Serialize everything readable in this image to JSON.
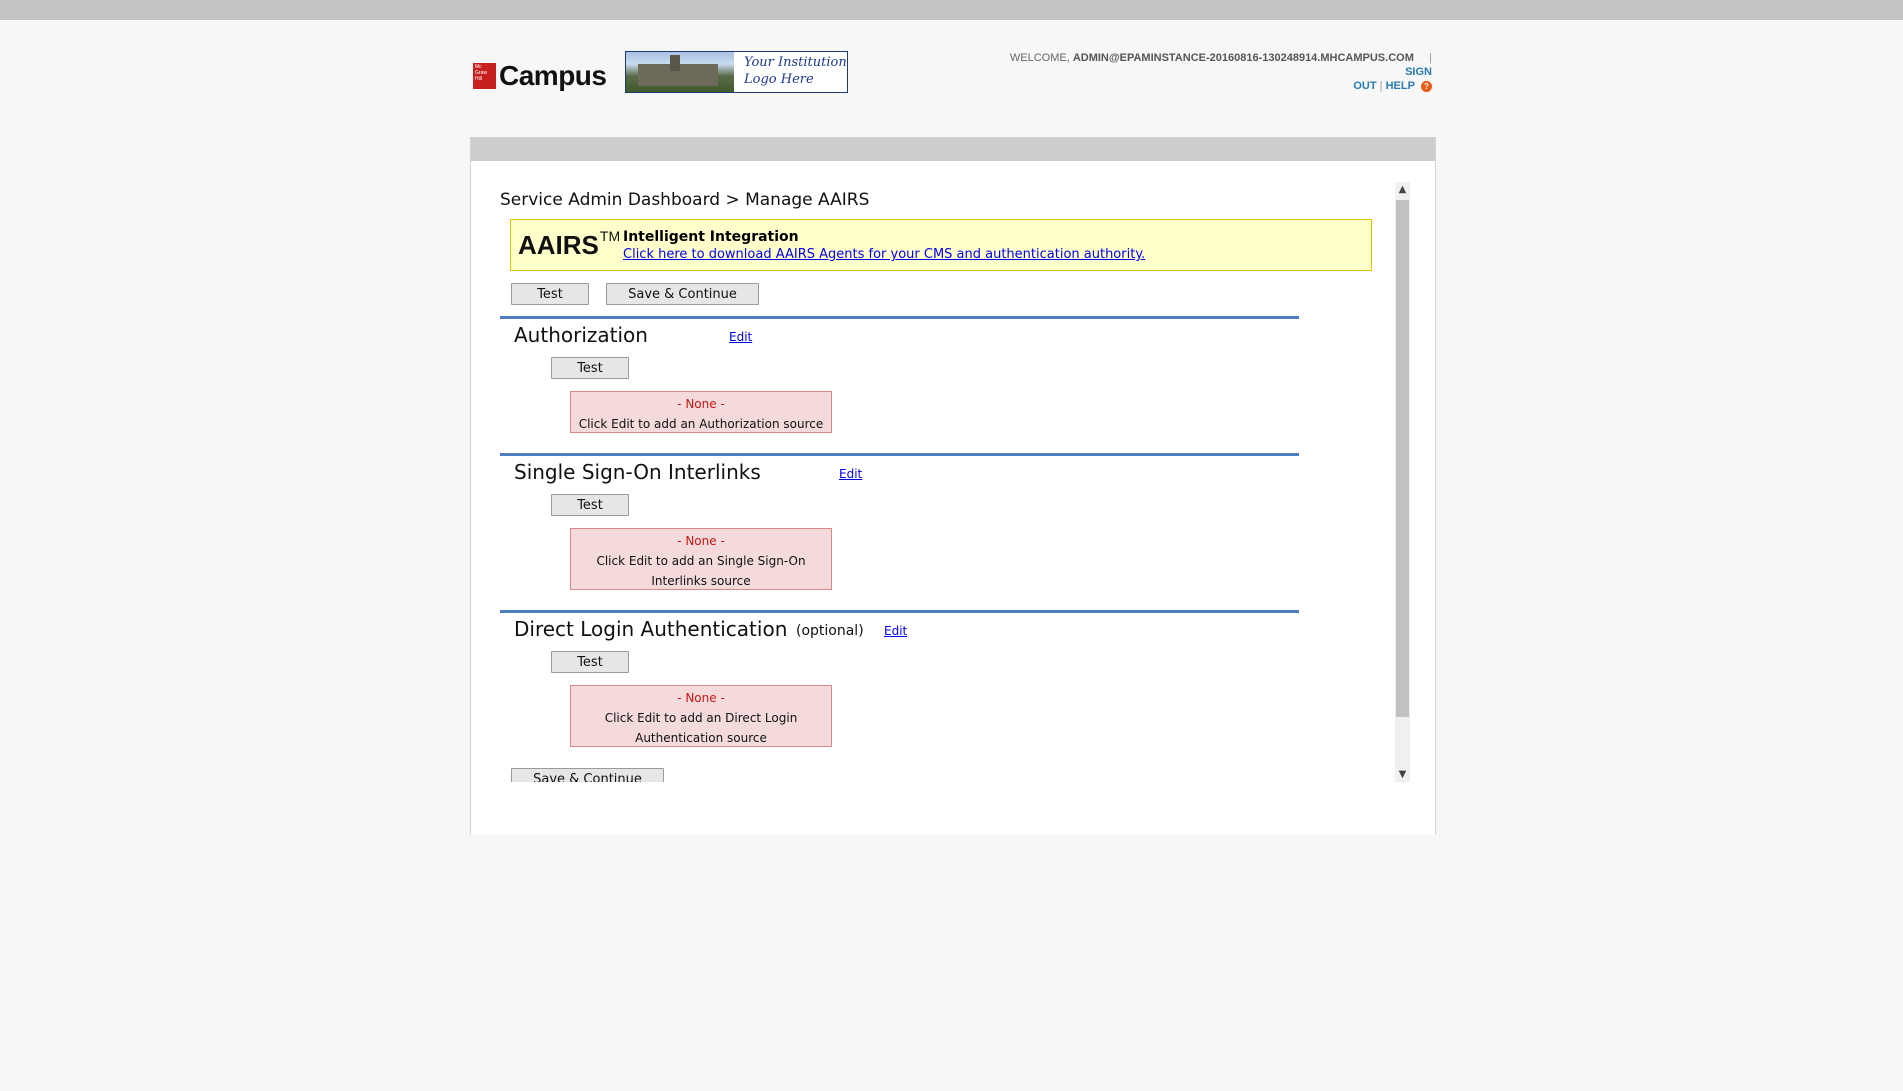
{
  "header": {
    "logo_text": "Campus",
    "logo_badge_text": "Mc Graw Hill",
    "institution_logo_line1": "Your Institution",
    "institution_logo_line2": "Logo Here",
    "welcome_prefix": "WELCOME,",
    "user_email": "ADMIN@EPAMINSTANCE-20160816-130248914.MHCAMPUS.COM",
    "sign_out_part1": "SIGN",
    "sign_out_part2": "OUT",
    "help_label": "HELP",
    "help_icon_glyph": "?"
  },
  "breadcrumb": "Service Admin Dashboard > Manage AAIRS",
  "banner": {
    "brand": "AAIRS",
    "trademark": "TM",
    "title": "Intelligent Integration",
    "download_link": "Click here to download AAIRS Agents for your CMS and authentication authority."
  },
  "top_actions": {
    "test_label": "Test",
    "save_continue_label": "Save & Continue"
  },
  "sections": [
    {
      "title": "Authorization",
      "optional": "",
      "edit_label": "Edit",
      "test_label": "Test",
      "none_label": "- None -",
      "none_message": "Click Edit to add an Authorization source"
    },
    {
      "title": "Single Sign-On Interlinks",
      "optional": "",
      "edit_label": "Edit",
      "test_label": "Test",
      "none_label": "- None -",
      "none_message": "Click Edit to add an Single Sign-On Interlinks source"
    },
    {
      "title": "Direct Login Authentication",
      "optional": "(optional)",
      "edit_label": "Edit",
      "test_label": "Test",
      "none_label": "- None -",
      "none_message": "Click Edit to add an Direct Login Authentication source"
    }
  ],
  "bottom_actions": {
    "save_continue_label": "Save & Continue"
  },
  "scrollbar": {
    "up_icon": "▲",
    "down_icon": "▼"
  },
  "colors": {
    "accent_line": "#4d7cc1",
    "banner_bg": "#ffffcc",
    "none_box_bg": "#f4dada",
    "none_text": "#c81818",
    "link": "#0000ee"
  }
}
